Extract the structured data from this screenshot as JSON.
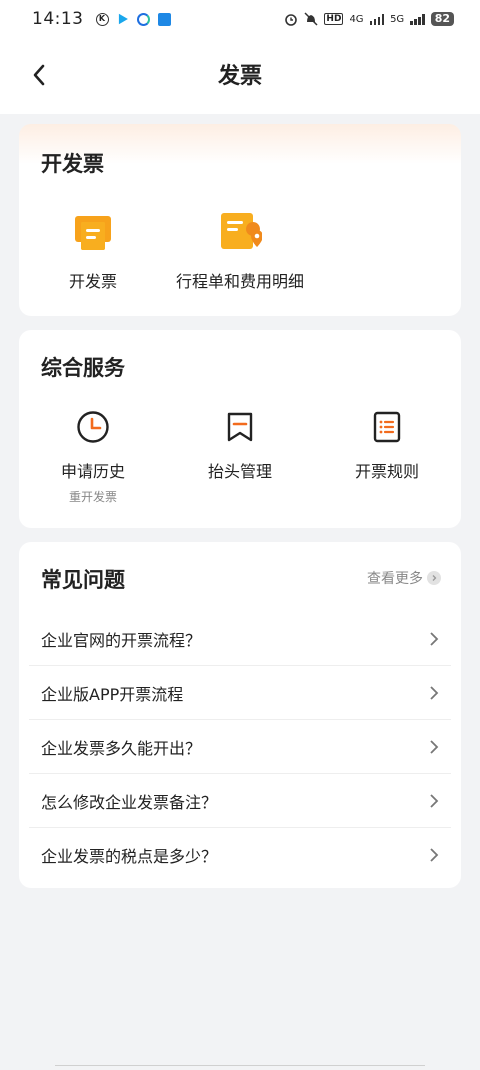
{
  "status_bar": {
    "time": "14:13",
    "network_4g": "4G",
    "network_5g": "5G",
    "hd": "HD",
    "battery": "82"
  },
  "nav": {
    "title": "发票"
  },
  "invoice_card": {
    "title": "开发票",
    "items": [
      {
        "label": "开发票",
        "icon": "invoice-stack-icon"
      },
      {
        "label": "行程单和费用明细",
        "icon": "itinerary-location-icon"
      }
    ]
  },
  "services_card": {
    "title": "综合服务",
    "items": [
      {
        "label": "申请历史",
        "sublabel": "重开发票",
        "icon": "clock-icon"
      },
      {
        "label": "抬头管理",
        "icon": "bookmark-icon"
      },
      {
        "label": "开票规则",
        "icon": "list-icon"
      }
    ]
  },
  "faq_card": {
    "title": "常见问题",
    "more_label": "查看更多",
    "items": [
      "企业官网的开票流程？",
      "企业版APP开票流程",
      "企业发票多久能开出？",
      "怎么修改企业发票备注？",
      "企业发票的税点是多少？"
    ]
  },
  "colors": {
    "accent": "#f7a21b",
    "accent_dark": "#f08a1c",
    "service_orange": "#f26b1d",
    "text": "#222222",
    "muted": "#888888",
    "background": "#f2f3f5"
  }
}
